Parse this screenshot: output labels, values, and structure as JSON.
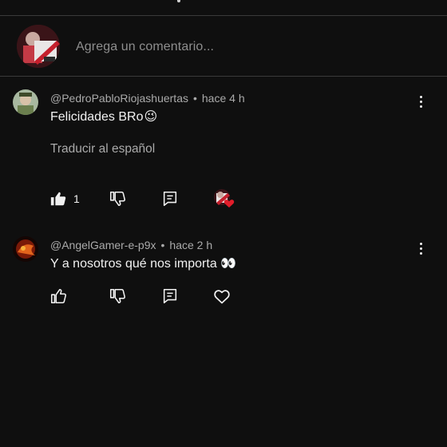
{
  "compose": {
    "placeholder": "Agrega un comentario..."
  },
  "comments": [
    {
      "author": "@PedroPabloRiojashuertas",
      "time": "hace 4 h",
      "text": "Felicidades BRo",
      "emoji": "😉",
      "translate_label": "Traducir al español",
      "likes": "1",
      "liked": true,
      "creator_heart": true
    },
    {
      "author": "@AngelGamer-e-p9x",
      "time": "hace 2 h",
      "text": "Y a nosotros qué nos importa",
      "emoji": "👀",
      "liked": false,
      "creator_heart": false
    }
  ],
  "colors": {
    "background": "#0f0f0f",
    "text_primary": "#f1f1f1",
    "text_secondary": "#aaaaaa",
    "heart_badge": "#e11d2a"
  },
  "icons": [
    "thumbs-up-icon",
    "thumbs-down-icon",
    "reply-icon",
    "heart-icon",
    "more-vert-icon"
  ]
}
